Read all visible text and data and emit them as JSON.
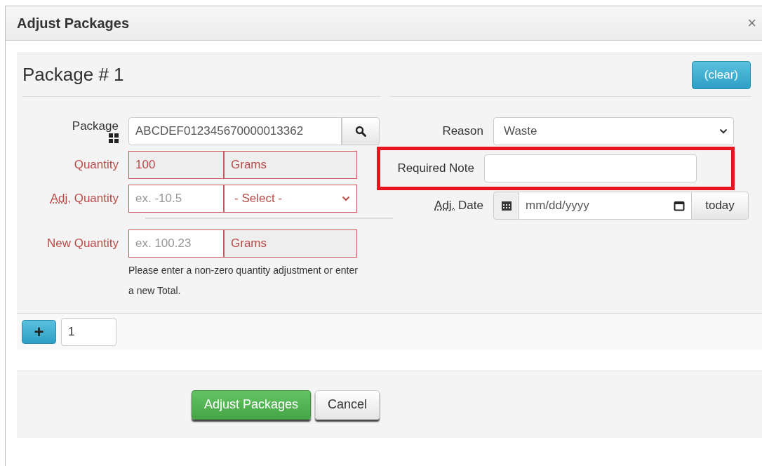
{
  "dialog": {
    "title": "Adjust Packages",
    "close": "×"
  },
  "package": {
    "heading": "Package # 1",
    "clear": "(clear)",
    "left_rows": [
      {
        "kind": "lookup",
        "label": "Package",
        "value": "ABCDEF012345670000013362",
        "error": false
      },
      {
        "kind": "readonly",
        "label": "Quantity",
        "value": "100",
        "unit": "Grams",
        "error": true
      },
      {
        "kind": "select",
        "label": "Adj.",
        "label_rest": " Quantity",
        "placeholder": "ex. -10.5",
        "select": "- Select -",
        "error": true
      },
      {
        "kind": "input",
        "label": "New Quantity",
        "placeholder": "ex. 100.23",
        "unit": "Grams",
        "error": true
      }
    ],
    "help": "Please enter a non-zero quantity adjustment or enter a new Total.",
    "right_rows": [
      {
        "kind": "select",
        "label": "Reason",
        "value": "Waste",
        "highlighted": false
      },
      {
        "kind": "text",
        "label": "Required Note",
        "highlighted": true
      },
      {
        "kind": "date",
        "label": "Adj.",
        "label_rest": " Date",
        "placeholder": "mm/dd/yyyy",
        "button": "today",
        "highlighted": false
      }
    ]
  },
  "add": {
    "button": "+",
    "count": "1"
  },
  "buttons": [
    {
      "label": "Adjust Packages",
      "kind": "primary"
    },
    {
      "label": "Cancel",
      "kind": "default"
    }
  ]
}
